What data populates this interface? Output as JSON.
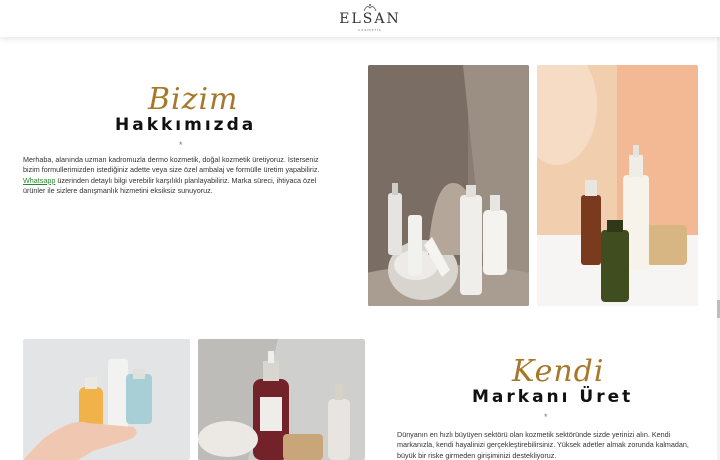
{
  "header": {
    "logo_text": "ELSAN",
    "logo_sub": "cosmetic"
  },
  "about": {
    "script_word": "Bizim",
    "heading": "Hakkımızda",
    "divider": "*",
    "text_before_link": "Merhaba, alanında uzman kadromuzla dermo kozmetik, doğal kozmetik üretiyoruz. İsterseniz bizim formullerimizden istediğiniz adette veya size özel ambalaj ve formülle üretim yapabiliriz. ",
    "link_text": "Whatsapp",
    "text_after_link": " üzerinden detaylı bilgi verebilir karşılıklı planlayabiliriz. Marka süreci, ihtiyaca özel ürünler ile sizlere danışmanlık hizmetini eksiksiz sunuyoruz."
  },
  "brand": {
    "script_word": "Kendi",
    "heading": "Markanı Üret",
    "divider": "*",
    "text": "Dünyanın en hızlı büyüyen sektörü olan kozmetik sektöründe sizde yerinizi alın. Kendi markanızla, kendi hayalinizi gerçekleştirebilirsiniz. Yüksek adetler almak zorunda kalmadan, büyük bir riske girmeden girişiminizi destekliyoruz."
  },
  "images": {
    "photo1": "products-on-stone-photo",
    "photo2": "serum-and-cream-bottles-photo",
    "photo3": "hand-holding-bottles-photo",
    "photo4": "dropper-bottles-photo"
  },
  "colors": {
    "accent_gold": "#a6782a",
    "link_green": "#2a8a2a",
    "heading": "#111111"
  }
}
